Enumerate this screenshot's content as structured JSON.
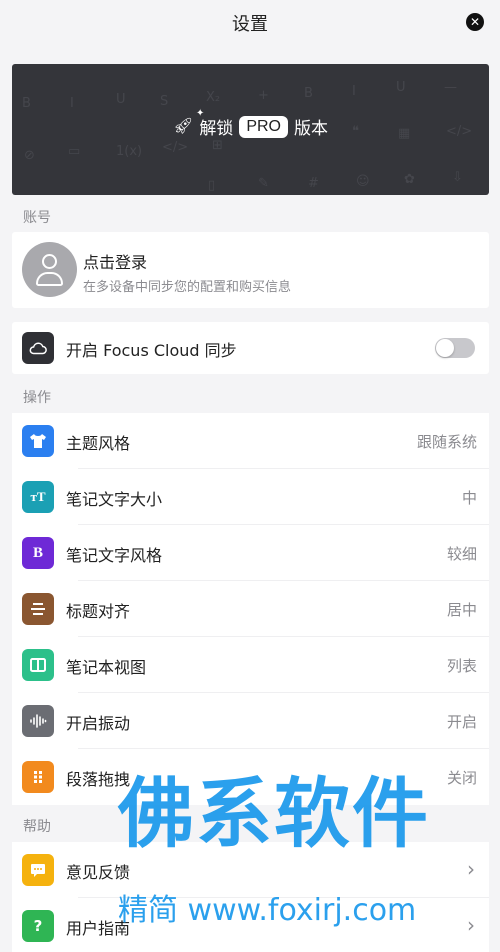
{
  "header": {
    "title": "设置",
    "close_icon": "close-icon"
  },
  "pro_banner": {
    "unlock_label": "解锁",
    "pro_label": "PRO",
    "version_label": "版本",
    "background_glyphs": [
      "B",
      "I",
      "U",
      "S",
      "X₂",
      "+",
      "B",
      "I",
      "U",
      "</>",
      "🔗",
      "▭",
      "1(x)",
      "</>",
      "⊞",
      "❝",
      "▯",
      "⊟",
      "▦",
      "⟨/⟩",
      "⊡",
      "✎",
      "#",
      "☺",
      "✿",
      "⇩"
    ]
  },
  "account_section": {
    "label": "账号",
    "login_title": "点击登录",
    "login_subtitle": "在多设备中同步您的配置和购买信息"
  },
  "cloud_sync": {
    "label": "开启 Focus Cloud 同步",
    "enabled": false,
    "icon_color": "#2f3035"
  },
  "operations_section": {
    "label": "操作",
    "items": [
      {
        "label": "主题风格",
        "value": "跟随系统",
        "icon": "shirt-icon",
        "color": "#2b7ff0"
      },
      {
        "label": "笔记文字大小",
        "value": "中",
        "icon": "text-size-icon",
        "color": "#1ba0b4"
      },
      {
        "label": "笔记文字风格",
        "value": "较细",
        "icon": "bold-icon",
        "color": "#6e29d6"
      },
      {
        "label": "标题对齐",
        "value": "居中",
        "icon": "align-center-icon",
        "color": "#8a5630"
      },
      {
        "label": "笔记本视图",
        "value": "列表",
        "icon": "columns-icon",
        "color": "#2cc08a"
      },
      {
        "label": "开启振动",
        "value": "开启",
        "icon": "waveform-icon",
        "color": "#6b6d73"
      },
      {
        "label": "段落拖拽",
        "value": "关闭",
        "icon": "drag-dots-icon",
        "color": "#f28a1e"
      }
    ]
  },
  "help_section": {
    "label": "帮助",
    "items": [
      {
        "label": "意见反馈",
        "icon": "feedback-icon",
        "color": "#f5b20e"
      },
      {
        "label": "用户指南",
        "icon": "question-icon",
        "color": "#2fb554"
      }
    ]
  },
  "watermark": {
    "main": "佛系软件",
    "sub": "精简 www.foxirj.com"
  }
}
